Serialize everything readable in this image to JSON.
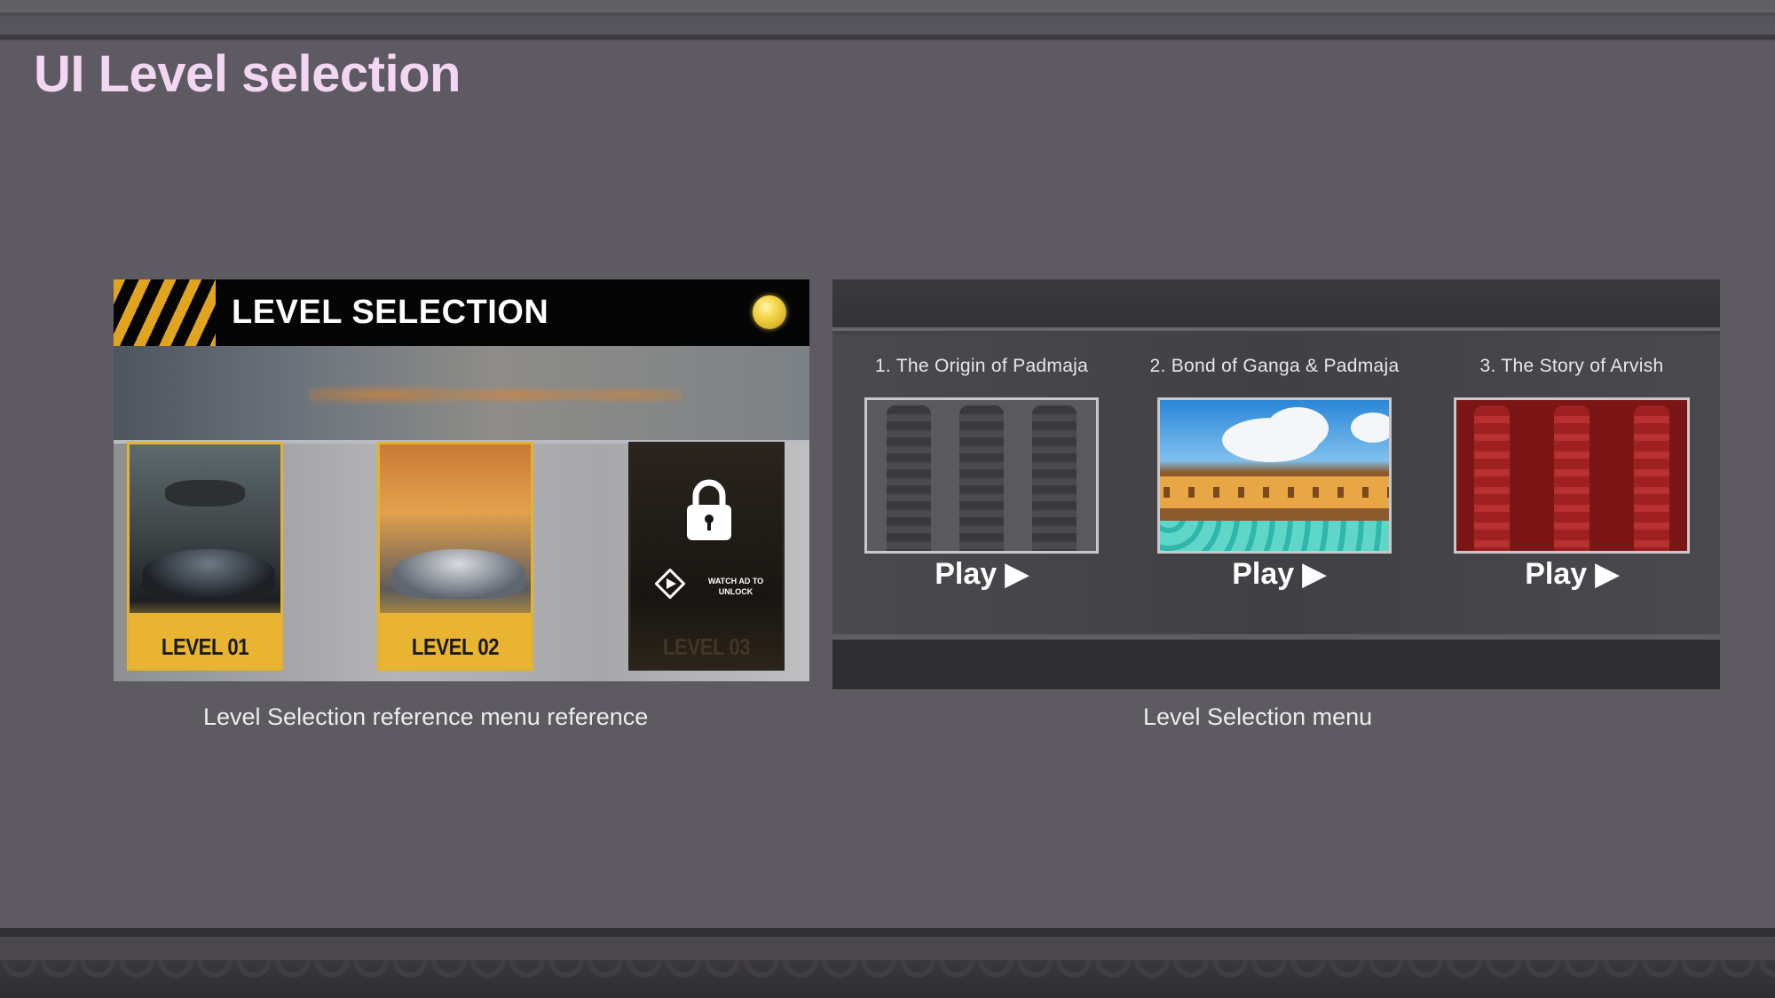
{
  "slide": {
    "title": "UI Level selection"
  },
  "reference_menu": {
    "header_title": "LEVEL SELECTION",
    "levels": [
      {
        "label": "LEVEL 01",
        "locked": false
      },
      {
        "label": "LEVEL 02",
        "locked": false
      },
      {
        "label": "LEVEL 03",
        "locked": true,
        "unlock_text": "WATCH AD TO\nUNLOCK"
      }
    ],
    "caption": "Level Selection reference menu reference"
  },
  "designed_menu": {
    "levels": [
      {
        "title": "1.  The Origin of Padmaja",
        "play_label": "Play ▶"
      },
      {
        "title": "2. Bond of Ganga & Padmaja",
        "play_label": "Play ▶"
      },
      {
        "title": "3. The Story of Arvish",
        "play_label": "Play ▶"
      }
    ],
    "caption": "Level Selection menu"
  },
  "colors": {
    "background": "#5d5a61",
    "title": "#f3d6f2",
    "accent_gold": "#e8b431"
  },
  "icons": [
    "coin-icon",
    "lock-icon",
    "watch-ad-icon",
    "play-icon"
  ]
}
